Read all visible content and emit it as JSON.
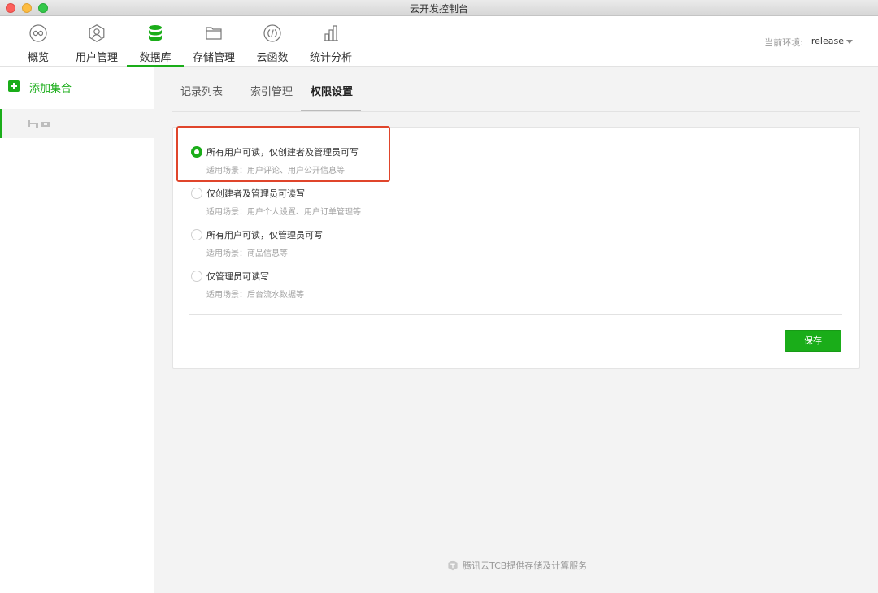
{
  "window": {
    "title": "云开发控制台"
  },
  "toolbar": {
    "items": [
      {
        "label": "概览",
        "icon": "infinity-icon"
      },
      {
        "label": "用户管理",
        "icon": "user-icon"
      },
      {
        "label": "数据库",
        "icon": "database-icon"
      },
      {
        "label": "存储管理",
        "icon": "folder-icon"
      },
      {
        "label": "云函数",
        "icon": "function-icon"
      },
      {
        "label": "统计分析",
        "icon": "bar-chart-icon"
      }
    ],
    "active_index": 2,
    "environment_label": "当前环境:",
    "environment_value": "release"
  },
  "sidebar": {
    "add_collection_label": "添加集合"
  },
  "tabs": [
    {
      "label": "记录列表"
    },
    {
      "label": "索引管理"
    },
    {
      "label": "权限设置"
    }
  ],
  "active_tab": 2,
  "permissions": {
    "options": [
      {
        "title": "所有用户可读，仅创建者及管理员可写",
        "desc": "适用场景：用户评论、用户公开信息等",
        "checked": true
      },
      {
        "title": "仅创建者及管理员可读写",
        "desc": "适用场景：用户个人设置、用户订单管理等",
        "checked": false
      },
      {
        "title": "所有用户可读，仅管理员可写",
        "desc": "适用场景：商品信息等",
        "checked": false
      },
      {
        "title": "仅管理员可读写",
        "desc": "适用场景：后台流水数据等",
        "checked": false
      }
    ],
    "save_label": "保存"
  },
  "footer": {
    "text": "腾讯云TCB提供存储及计算服务"
  },
  "colors": {
    "accent": "#1aad19",
    "highlight": "#e0452b"
  }
}
